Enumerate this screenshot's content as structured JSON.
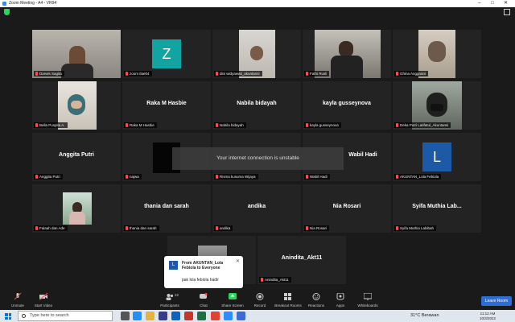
{
  "window": {
    "title": "Zoom Meeting - A4 - VR94"
  },
  "participants": [
    {
      "name": "Darwis Sagita",
      "active": true
    },
    {
      "name": "zoom Ilae04",
      "avatar_letter": "Z",
      "avatar_color": "#12a3a3"
    },
    {
      "name": "dini widyawati_akuntansi"
    },
    {
      "name": "Fathi Rusli"
    },
    {
      "name": "Ghina Anggraini"
    },
    {
      "name": "Bella Puspita A."
    },
    {
      "name": "Raka M Hasbie",
      "display": "Raka M Hasbie"
    },
    {
      "name": "Nabila bidayah",
      "display": "Nabila bidayah"
    },
    {
      "name": "kayla gusseynova",
      "display": "kayla gusseynova"
    },
    {
      "name": "Deka Putri Latifatul_Akuntansi"
    },
    {
      "name": "Anggita Putri",
      "display": "Anggita Putri"
    },
    {
      "name": "najwa"
    },
    {
      "name": "Risma kusuma Wijaya"
    },
    {
      "name": "Wabil Hadi",
      "display": "Wabil Hadi"
    },
    {
      "name": "AKUNTAN_Lola Febiola",
      "avatar_letter": "L",
      "avatar_color": "#1c5aa8"
    },
    {
      "name": "Falaah dan Ade"
    },
    {
      "name": "thania dan sarah",
      "display": "thania dan sarah"
    },
    {
      "name": "andika",
      "display": "andika"
    },
    {
      "name": "Nia Rosari",
      "display": "Nia Rosari"
    },
    {
      "name": "Syifa Muthia Labibah",
      "display": "Syifa Muthia Lab..."
    },
    {
      "name": "Anindita_Akt11",
      "display": "Anindita_Akt11"
    }
  ],
  "warning": "Your internet connection is unstable",
  "chat_popup": {
    "avatar_letter": "L",
    "from": "From AKUNTAN_Lola Febiola to Everyone",
    "message": "pak lola febiola hadir"
  },
  "toolbar": {
    "unmute": "Unmute",
    "start_video": "Start Video",
    "participants": "Participants",
    "participants_count": "22",
    "chat": "Chat",
    "share_screen": "Share Screen",
    "record": "Record",
    "breakout": "Breakout Rooms",
    "reactions": "Reactions",
    "apps": "Apps",
    "whiteboards": "Whiteboards",
    "leave": "Leave Room"
  },
  "taskbar": {
    "search_placeholder": "Type here to search",
    "weather": "31°C  Berawan",
    "time": "11:12 AM",
    "date": "10/3/2022"
  },
  "colors": {
    "accent": "#2d8cff",
    "active_border": "#d6e93a",
    "share_green": "#23d959",
    "mute_red": "#ff4d4d"
  }
}
